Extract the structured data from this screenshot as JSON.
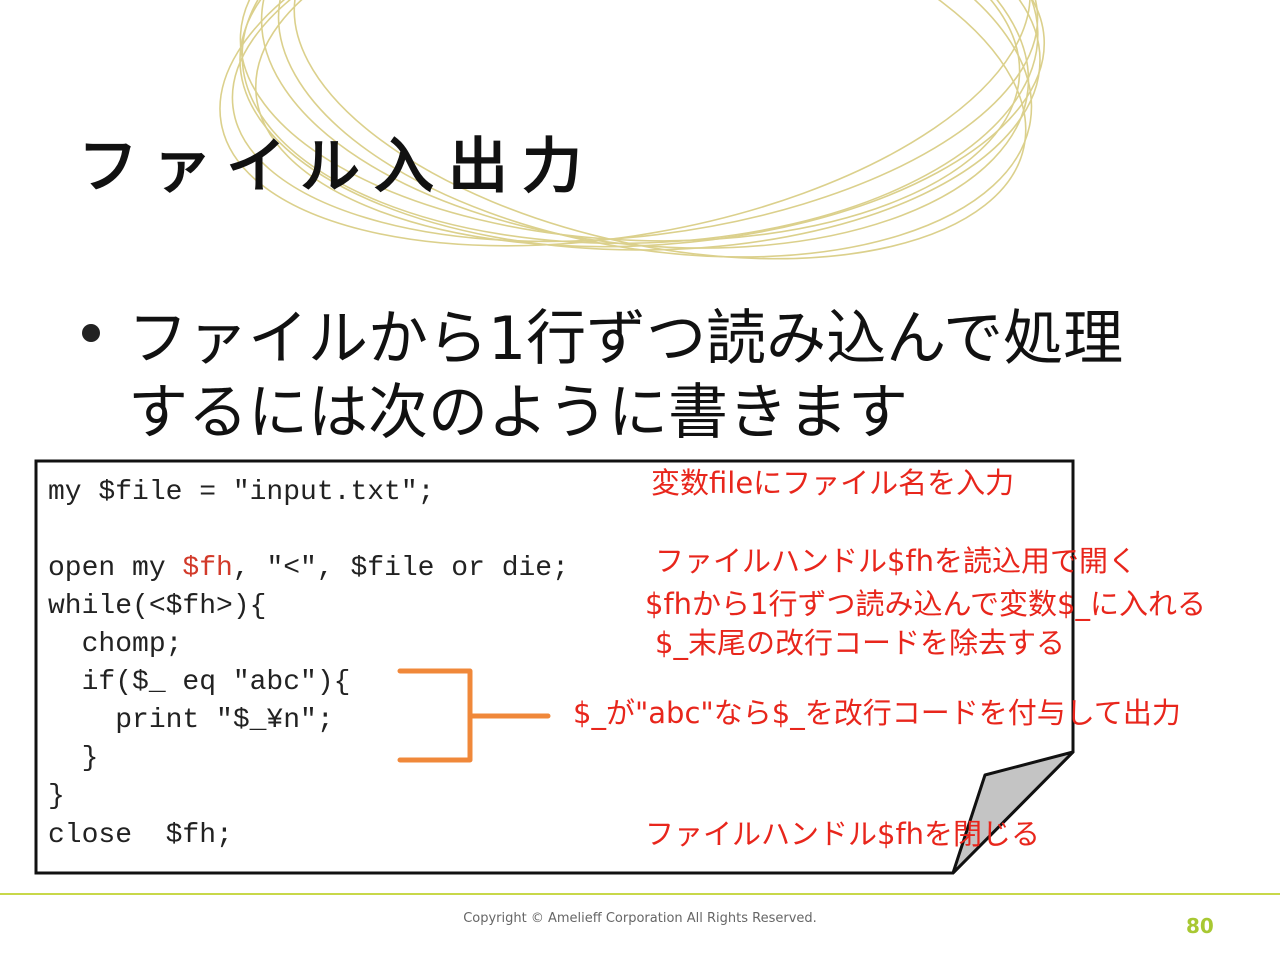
{
  "slide": {
    "title": "ファイル入出力",
    "bullet": {
      "line1": "ファイルから1行ずつ読み込んで処理",
      "line2": "するには次のように書きます"
    },
    "code": {
      "line1": "my $file = \"input.txt\";",
      "line2_pre": "open my ",
      "line2_var": "$fh",
      "line2_post": ", \"<\", $file or die;",
      "line3": "while(<$fh>){",
      "line4": "  chomp;",
      "line5": "  if($_ eq \"abc\"){",
      "line6": "    print \"$_¥n\";",
      "line7": "  }",
      "line8": "}",
      "line9": "close  $fh;"
    },
    "annotations": {
      "a1": "変数fileにファイル名を入力",
      "a2": "ファイルハンドル$fhを読込用で開く",
      "a3": "$fhから1行ずつ読み込んで変数$_に入れる",
      "a4": "$_末尾の改行コードを除去する",
      "a5": "$_が\"abc\"なら$_を改行コードを付与して出力",
      "a6": "ファイルハンドル$fhを閉じる"
    },
    "footer": {
      "copyright": "Copyright © Amelieff Corporation All Rights Reserved.",
      "page_number": "80"
    },
    "colors": {
      "annotation": "#e8261c",
      "brace": "#f0883a",
      "accent_line": "#c8d84a",
      "page_number": "#a8c832",
      "rings": "#d8cc80"
    }
  }
}
